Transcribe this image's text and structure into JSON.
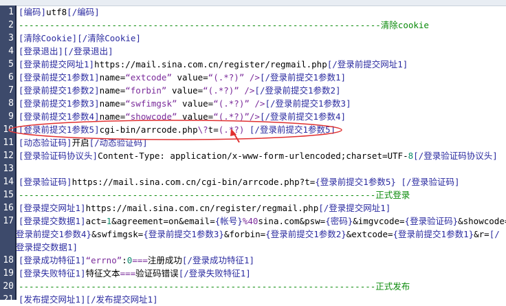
{
  "colors": {
    "annotation": "#e03030",
    "gutter": "#3d4a6b"
  },
  "lines": [
    {
      "n": "1",
      "seg": [
        [
          "tag",
          "[编码]"
        ],
        [
          "txt",
          "utf8"
        ],
        [
          "tag",
          "[/编码]"
        ]
      ]
    },
    {
      "n": "2",
      "seg": [
        [
          "sep",
          "----------------------------------------------------------------------清除cookie"
        ]
      ]
    },
    {
      "n": "3",
      "seg": [
        [
          "tag",
          "[清除Cookie][/清除Cookie]"
        ]
      ]
    },
    {
      "n": "4",
      "seg": [
        [
          "tag",
          "[登录退出][/登录退出]"
        ]
      ]
    },
    {
      "n": "5",
      "seg": [
        [
          "tag",
          "[登录前提交网址1]"
        ],
        [
          "txt",
          "https://mail.sina.com.cn/register/regmail.php"
        ],
        [
          "tag",
          "[/登录前提交网址1]"
        ]
      ]
    },
    {
      "n": "6",
      "seg": [
        [
          "tag",
          "[登录前提交1参数1]"
        ],
        [
          "txt",
          "name="
        ],
        [
          "str",
          "“extcode”"
        ],
        [
          "txt",
          " value="
        ],
        [
          "str",
          "“(.*?)” />"
        ],
        [
          "tag",
          "[/登录前提交1参数1]"
        ]
      ]
    },
    {
      "n": "7",
      "seg": [
        [
          "tag",
          "[登录前提交1参数2]"
        ],
        [
          "txt",
          "name="
        ],
        [
          "str",
          "“forbin”"
        ],
        [
          "txt",
          " value="
        ],
        [
          "str",
          "“(.*?)” />"
        ],
        [
          "tag",
          "[/登录前提交1参数2]"
        ]
      ]
    },
    {
      "n": "8",
      "seg": [
        [
          "tag",
          "[登录前提交1参数3]"
        ],
        [
          "txt",
          "name="
        ],
        [
          "str",
          "“swfimgsk”"
        ],
        [
          "txt",
          " value="
        ],
        [
          "str",
          "“(.*?)” />"
        ],
        [
          "tag",
          "[/登录前提交1参数3]"
        ]
      ]
    },
    {
      "n": "9",
      "seg": [
        [
          "tag",
          "[登录前提交1参数4]"
        ],
        [
          "txt",
          "name="
        ],
        [
          "str",
          "“showcode”"
        ],
        [
          "txt",
          "  value="
        ],
        [
          "str",
          "“(.*?)”/>"
        ],
        [
          "tag",
          "[/登录前提交1参数4]"
        ]
      ]
    },
    {
      "n": "10",
      "seg": [
        [
          "tag",
          "[登录前提交1参数5]"
        ],
        [
          "txt",
          "cgi-bin/arrcode.php"
        ],
        [
          "str",
          "\\?"
        ],
        [
          "txt",
          "t="
        ],
        [
          "str",
          "(.*?)"
        ],
        [
          "tag",
          " [/登录前提交1参数5]"
        ]
      ]
    },
    {
      "n": "11",
      "seg": [
        [
          "tag",
          "[动态验证码]"
        ],
        [
          "txt",
          "开启"
        ],
        [
          "tag",
          "[/动态验证码]"
        ]
      ]
    },
    {
      "n": "12",
      "seg": [
        [
          "tag",
          "[登录验证码协议头]"
        ],
        [
          "txt",
          "Content-Type: application/x-www-form-urlencoded;charset=UTF-"
        ],
        [
          "num2",
          "8"
        ],
        [
          "tag",
          "[/登录验证码协议头]"
        ]
      ]
    },
    {
      "n": "13",
      "seg": []
    },
    {
      "n": "14",
      "seg": [
        [
          "tag",
          "[登录验证码]"
        ],
        [
          "txt",
          "https://mail.sina.com.cn/cgi-bin/arrcode.php?t="
        ],
        [
          "tag",
          "{登录前提交1参数5}"
        ],
        [
          "tag",
          " [/登录验证码]"
        ]
      ]
    },
    {
      "n": "15",
      "seg": [
        [
          "sep",
          "---------------------------------------------------------------------正式登录"
        ]
      ]
    },
    {
      "n": "16",
      "seg": [
        [
          "tag",
          "[登录提交网址1]"
        ],
        [
          "txt",
          "https://mail.sina.com.cn/register/regmail.php"
        ],
        [
          "tag",
          "[/登录提交网址1]"
        ]
      ]
    },
    {
      "n": "17",
      "seg": [
        [
          "tag",
          "[登录提交数据1]"
        ],
        [
          "txt",
          "act="
        ],
        [
          "num2",
          "1"
        ],
        [
          "txt",
          "&agreement=on&email="
        ],
        [
          "tag",
          "{帐号}"
        ],
        [
          "str",
          "%40"
        ],
        [
          "txt",
          "sina.com&psw="
        ],
        [
          "tag",
          "{密码}"
        ],
        [
          "txt",
          "&imgvcode="
        ],
        [
          "tag",
          "{登录验证码}"
        ],
        [
          "txt",
          "&showcode="
        ],
        [
          "tag",
          "{"
        ]
      ]
    },
    {
      "n": "",
      "cont": true,
      "seg": [
        [
          "tag",
          "登录前提交1参数4}"
        ],
        [
          "txt",
          "&swfimgsk="
        ],
        [
          "tag",
          "{登录前提交1参数3}"
        ],
        [
          "txt",
          "&forbin="
        ],
        [
          "tag",
          "{登录前提交1参数2}"
        ],
        [
          "txt",
          "&extcode="
        ],
        [
          "tag",
          "{登录前提交1参数1}"
        ],
        [
          "txt",
          "&r="
        ],
        [
          "tag",
          "[/"
        ]
      ]
    },
    {
      "n": "",
      "cont": true,
      "seg": [
        [
          "tag",
          "登录提交数据1]"
        ]
      ]
    },
    {
      "n": "18",
      "seg": [
        [
          "tag",
          "[登录成功特征1]"
        ],
        [
          "str",
          "“errno”"
        ],
        [
          "txt",
          ":"
        ],
        [
          "num2",
          "0"
        ],
        [
          "str",
          "==="
        ],
        [
          "txt",
          "注册成功"
        ],
        [
          "tag",
          "[/登录成功特征1]"
        ]
      ]
    },
    {
      "n": "19",
      "seg": [
        [
          "tag",
          "[登录失败特征1]"
        ],
        [
          "txt",
          "特征文本"
        ],
        [
          "str",
          "==="
        ],
        [
          "txt",
          "验证码错误"
        ],
        [
          "tag",
          "[/登录失败特征1]"
        ]
      ]
    },
    {
      "n": "20",
      "seg": [
        [
          "sep",
          "---------------------------------------------------------------------正式发布"
        ]
      ]
    },
    {
      "n": "21",
      "seg": [
        [
          "tag",
          "[发布提交网址1][/发布提交网址1]"
        ]
      ]
    }
  ]
}
